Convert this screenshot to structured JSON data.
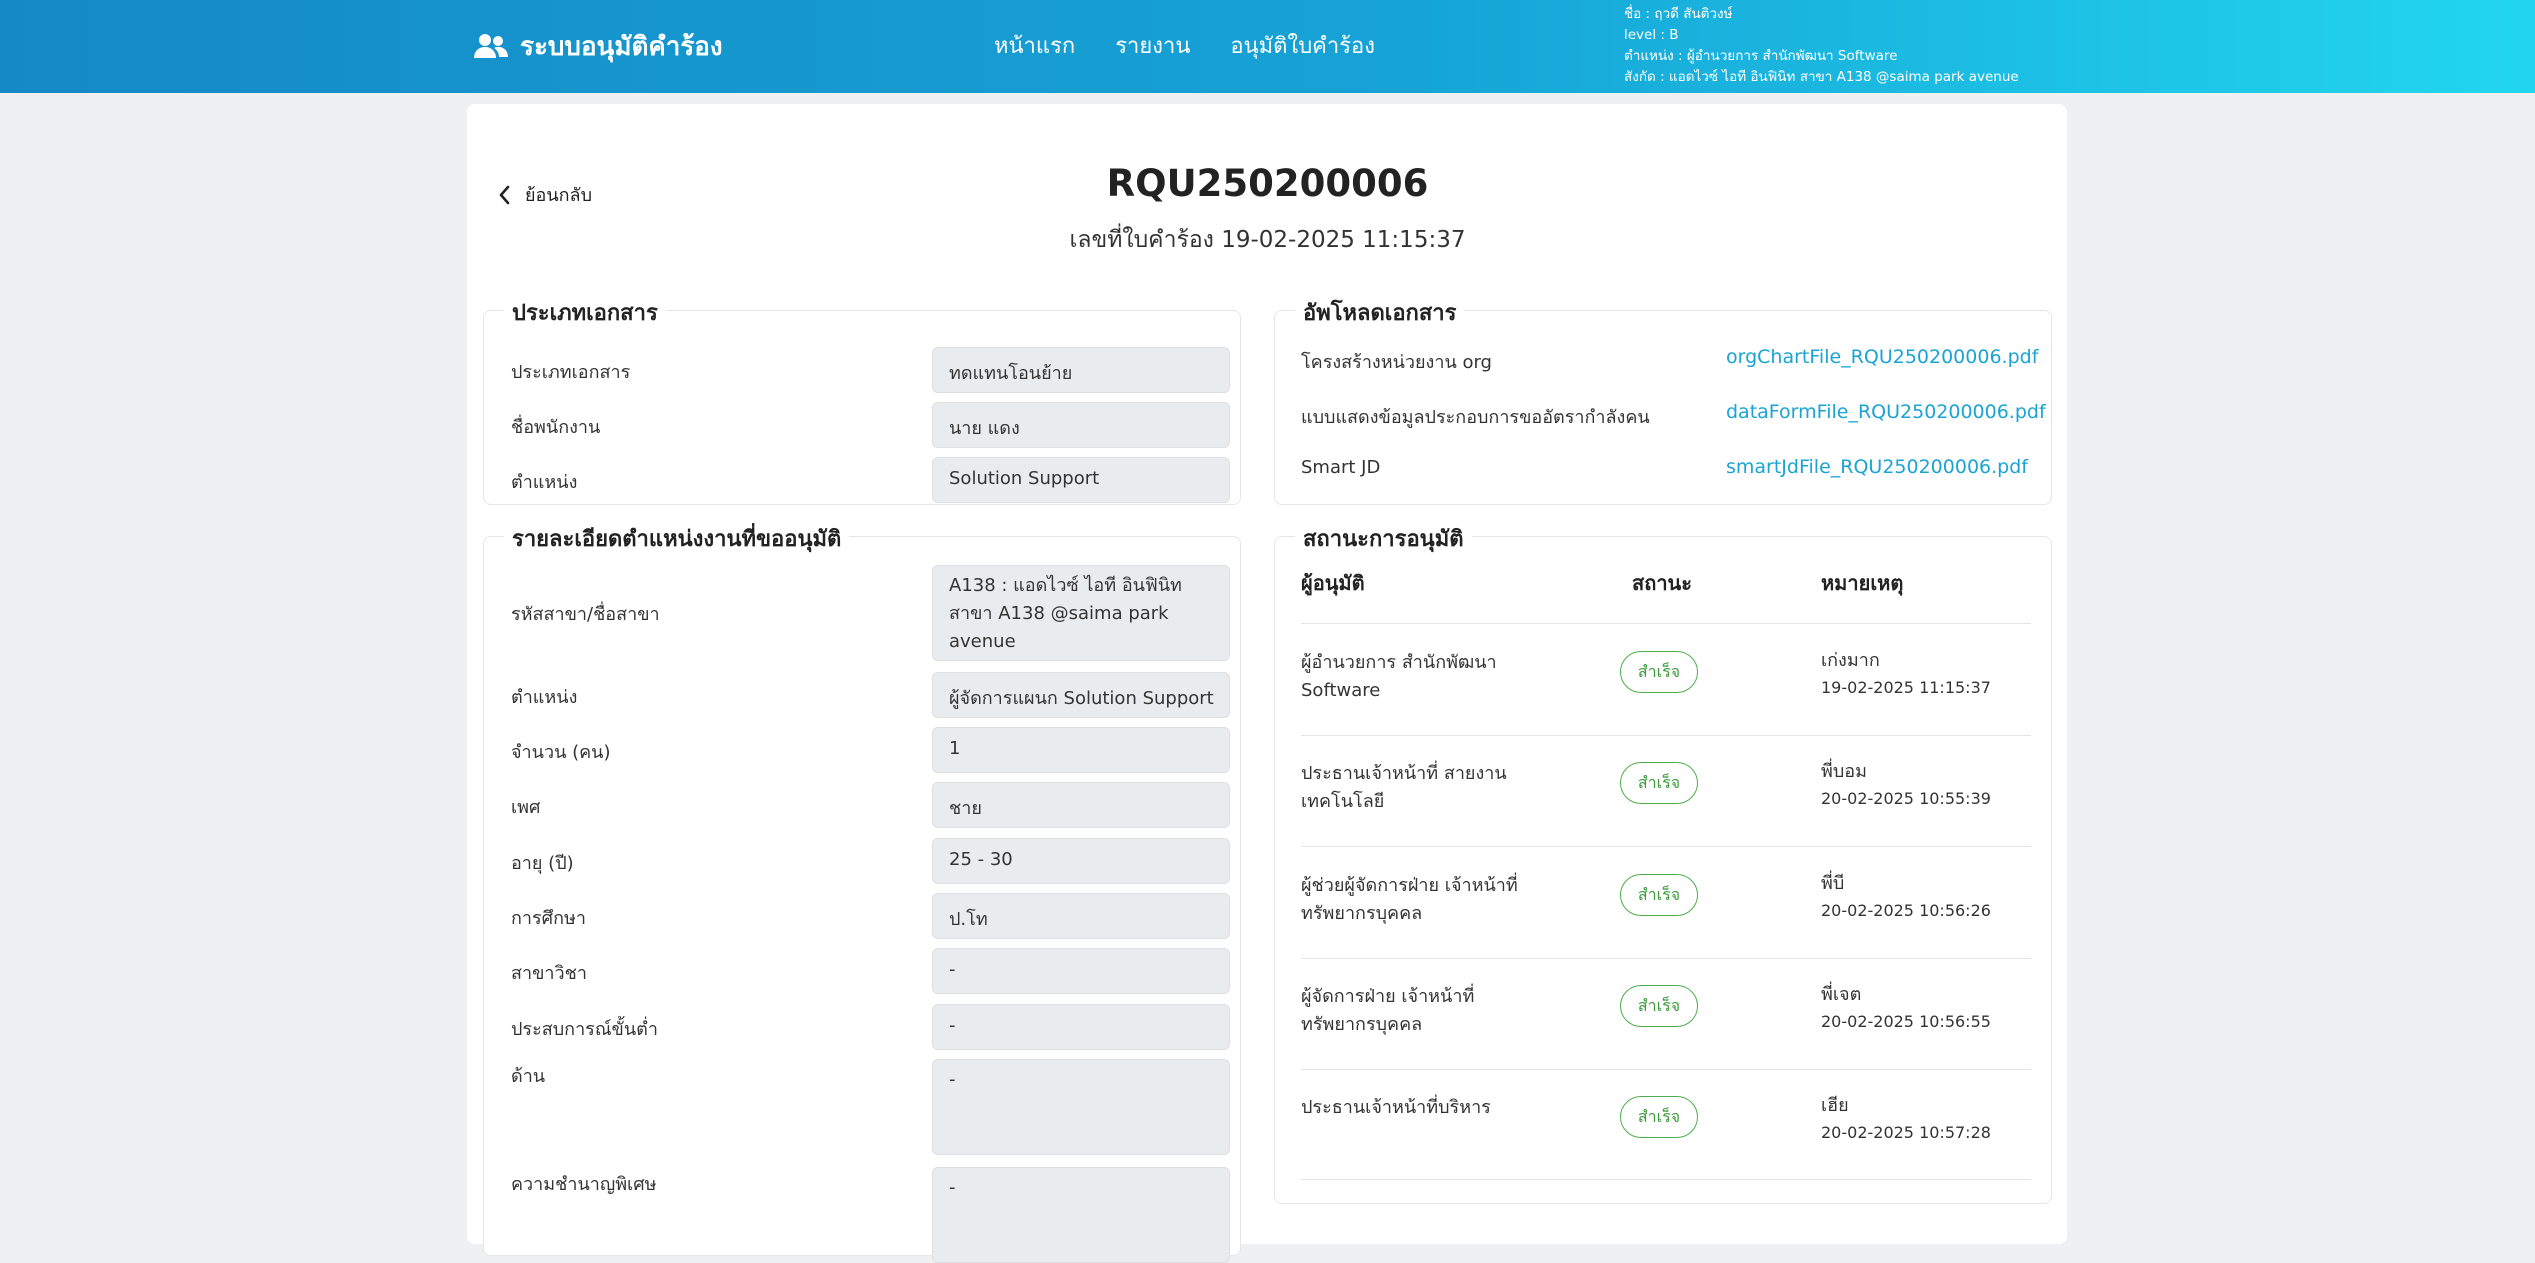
{
  "header": {
    "app_title": "ระบบอนุมัติคำร้อง",
    "nav": [
      "หน้าแรก",
      "รายงาน",
      "อนุมัติใบคำร้อง"
    ],
    "user": {
      "name": "ชื่อ : ฤวดี สันติวงษ์",
      "level": "level : B",
      "position": "ตำแหน่ง : ผู้อำนวยการ สำนักพัฒนา Software",
      "affiliation": "สังกัด : แอดไวซ์ ไอที อินฟินิท สาขา A138 @saima park avenue"
    }
  },
  "page": {
    "back_label": "ย้อนกลับ",
    "request_no": "RQU250200006",
    "subtitle": "เลขที่ใบคำร้อง 19-02-2025 11:15:37"
  },
  "doc_type": {
    "title": "ประเภทเอกสาร",
    "rows": [
      {
        "label": "ประเภทเอกสาร",
        "value": "ทดแทนโอนย้าย"
      },
      {
        "label": "ชื่อพนักงาน",
        "value": "นาย แดง"
      },
      {
        "label": "ตำแหน่ง",
        "value": "Solution Support"
      }
    ]
  },
  "upload": {
    "title": "อัพโหลดเอกสาร",
    "files": [
      {
        "label": "โครงสร้างหน่วยงาน org",
        "file": "orgChartFile_RQU250200006.pdf"
      },
      {
        "label": "แบบแสดงข้อมูลประกอบการขออัตรากำลังคน",
        "file": "dataFormFile_RQU250200006.pdf"
      },
      {
        "label": "Smart JD",
        "file": "smartJdFile_RQU250200006.pdf"
      }
    ]
  },
  "position_detail": {
    "title": "รายละเอียดตำแหน่งงานที่ขออนุมัติ",
    "rows": [
      {
        "label": "รหัสสาขา/ชื่อสาขา",
        "value": "A138 : แอดไวซ์ ไอที อินฟินิท สาขา A138 @saima park avenue"
      },
      {
        "label": "ตำแหน่ง",
        "value": "ผู้จัดการแผนก Solution Support"
      },
      {
        "label": "จำนวน (คน)",
        "value": "1"
      },
      {
        "label": "เพศ",
        "value": "ชาย"
      },
      {
        "label": "อายุ (ปี)",
        "value": "25 - 30"
      },
      {
        "label": "การศึกษา",
        "value": "ป.โท"
      },
      {
        "label": "สาขาวิชา",
        "value": "-"
      },
      {
        "label": "ประสบการณ์ขั้นต่ำ",
        "value": "-"
      },
      {
        "label": "ด้าน",
        "value": "-"
      },
      {
        "label": "ความชำนาญพิเศษ",
        "value": "-"
      }
    ]
  },
  "approval": {
    "title": "สถานะการอนุมัติ",
    "columns": [
      "ผู้อนุมัติ",
      "สถานะ",
      "หมายเหตุ"
    ],
    "rows": [
      {
        "approver": "ผู้อำนวยการ สำนักพัฒนา Software",
        "status": "สำเร็จ",
        "note": "เก่งมาก",
        "time": "19-02-2025 11:15:37"
      },
      {
        "approver": "ประธานเจ้าหน้าที่ สายงานเทคโนโลยี",
        "status": "สำเร็จ",
        "note": "พี่บอม",
        "time": "20-02-2025 10:55:39"
      },
      {
        "approver": "ผู้ช่วยผู้จัดการฝ่าย เจ้าหน้าที่ทรัพยากรบุคคล",
        "status": "สำเร็จ",
        "note": "พี่บี",
        "time": "20-02-2025 10:56:26"
      },
      {
        "approver": "ผู้จัดการฝ่าย เจ้าหน้าที่ทรัพยากรบุคคล",
        "status": "สำเร็จ",
        "note": "พี่เจต",
        "time": "20-02-2025 10:56:55"
      },
      {
        "approver": "ประธานเจ้าหน้าที่บริหาร",
        "status": "สำเร็จ",
        "note": "เฮีย",
        "time": "20-02-2025 10:57:28"
      }
    ]
  },
  "colors": {
    "header_start": "#1589c6",
    "header_end": "#22d6ef",
    "link": "#1aa4d4",
    "success": "#4cae4c"
  }
}
